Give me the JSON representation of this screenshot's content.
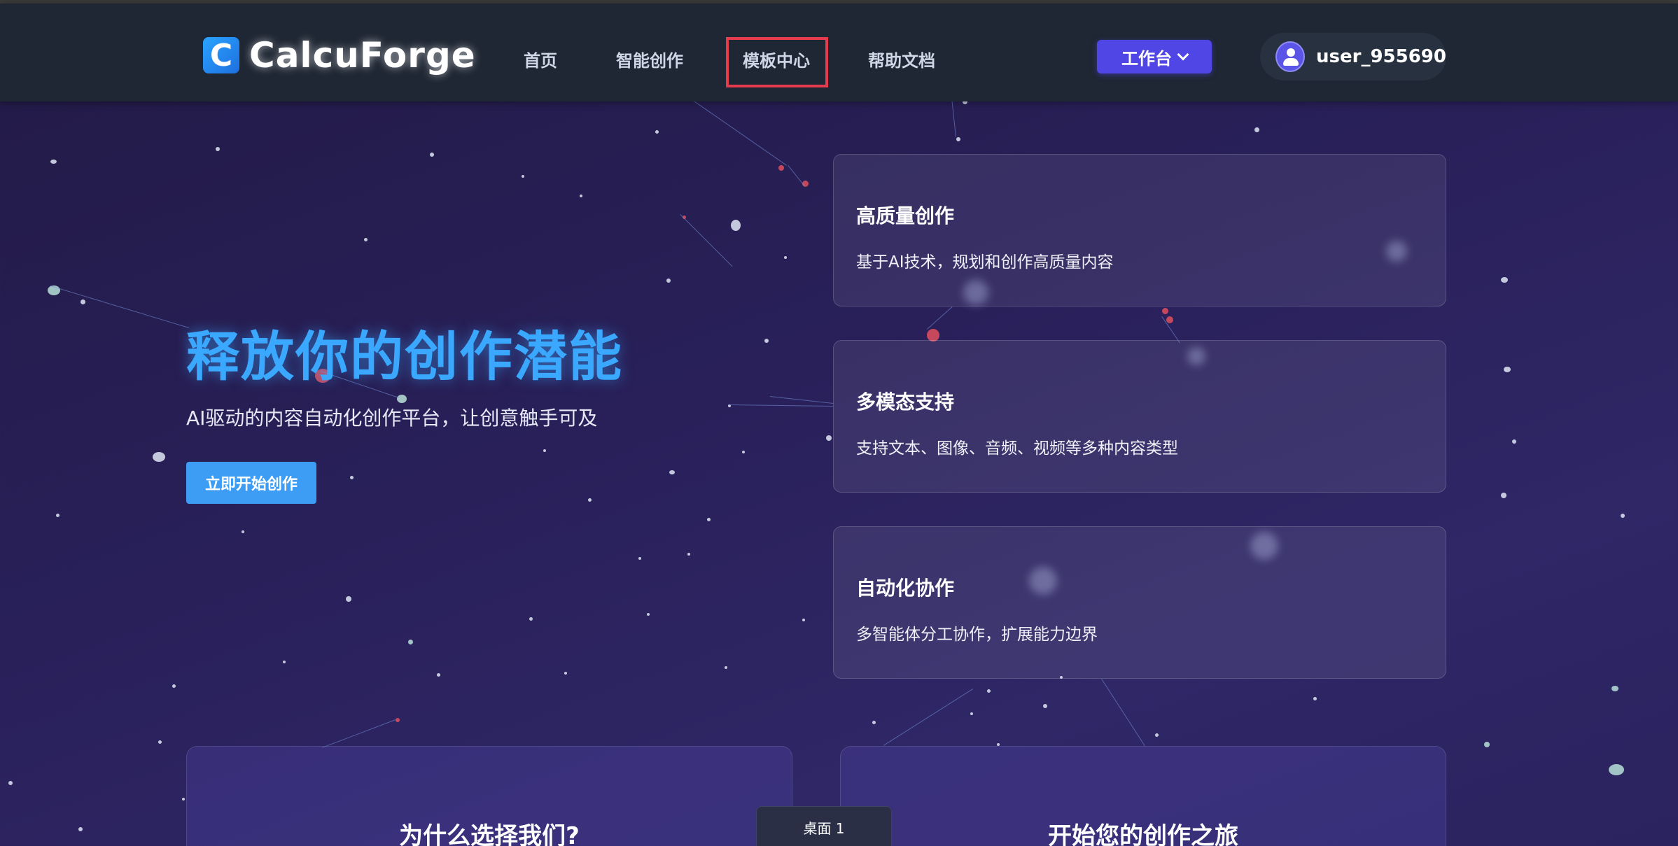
{
  "header": {
    "logo_letter": "C",
    "logo_text": "CalcuForge",
    "nav": [
      {
        "label": "首页"
      },
      {
        "label": "智能创作"
      },
      {
        "label": "模板中心"
      },
      {
        "label": "帮助文档"
      }
    ],
    "workbench_label": "工作台",
    "username": "user_955690"
  },
  "hero": {
    "title": "释放你的创作潜能",
    "subtitle": "AI驱动的内容自动化创作平台，让创意触手可及",
    "cta_label": "立即开始创作"
  },
  "features": [
    {
      "title": "高质量创作",
      "desc": "基于AI技术，规划和创作高质量内容"
    },
    {
      "title": "多模态支持",
      "desc": "支持文本、图像、音频、视频等多种内容类型"
    },
    {
      "title": "自动化协作",
      "desc": "多智能体分工协作，扩展能力边界"
    }
  ],
  "bottom_cards": [
    {
      "title": "为什么选择我们?"
    },
    {
      "title": "开始您的创作之旅"
    }
  ],
  "desktop_tab": "桌面 1",
  "colors": {
    "accent": "#4f46e5",
    "hero_title": "#3aa8ff",
    "cta": "#3d9cf4",
    "highlight_border": "#e53b4c",
    "header_bg": "#1f2734"
  }
}
